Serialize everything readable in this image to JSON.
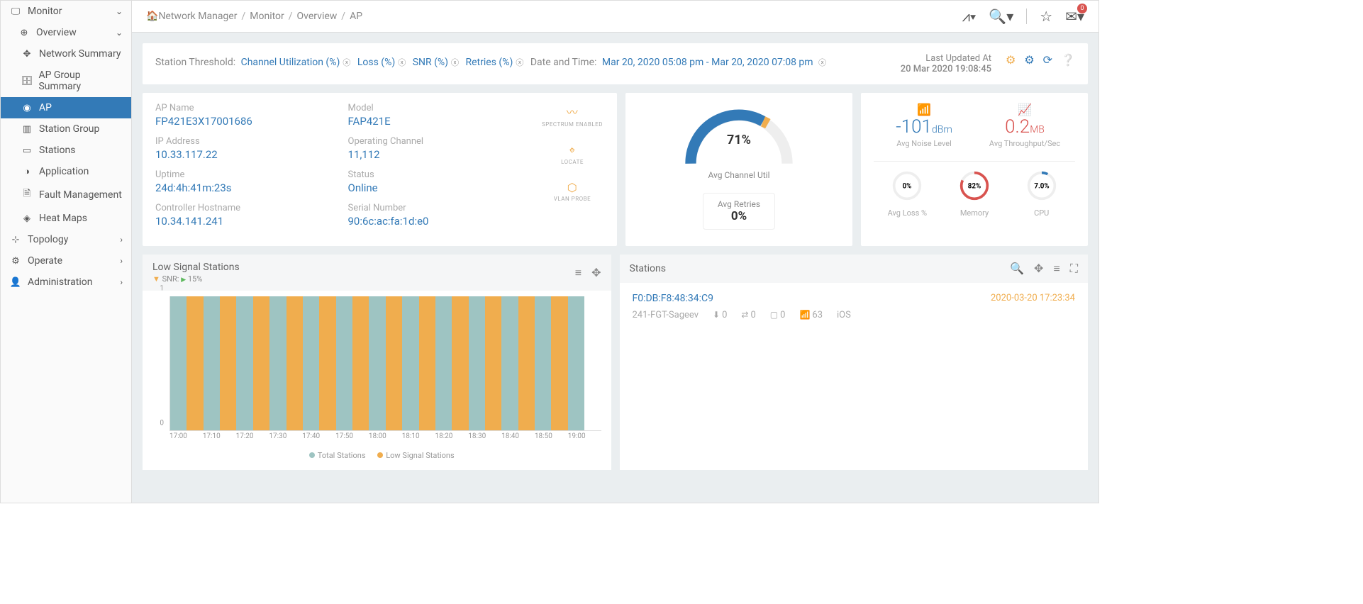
{
  "sidebar": {
    "items": [
      {
        "label": "Monitor",
        "icon": "🖵",
        "level": 1,
        "chev": "⌄"
      },
      {
        "label": "Overview",
        "icon": "⊕",
        "level": 2,
        "chev": "⌄"
      },
      {
        "label": "Network Summary",
        "icon": "✥",
        "level": 3
      },
      {
        "label": "AP Group Summary",
        "icon": "🗄",
        "level": 3
      },
      {
        "label": "AP",
        "icon": "◉",
        "level": 3,
        "active": true
      },
      {
        "label": "Station Group",
        "icon": "▥",
        "level": 3
      },
      {
        "label": "Stations",
        "icon": "▭",
        "level": 3
      },
      {
        "label": "Application",
        "icon": "◑",
        "level": 3
      },
      {
        "label": "Fault Management",
        "icon": "🗎",
        "level": 3
      },
      {
        "label": "Heat Maps",
        "icon": "◈",
        "level": 3
      },
      {
        "label": "Topology",
        "icon": "⊹",
        "level": 1,
        "chev": "›"
      },
      {
        "label": "Operate",
        "icon": "⚙",
        "level": 1,
        "chev": "›"
      },
      {
        "label": "Administration",
        "icon": "👤",
        "level": 1,
        "chev": "›"
      }
    ]
  },
  "breadcrumb": [
    "Network Manager",
    "Monitor",
    "Overview",
    "AP"
  ],
  "topbar": {
    "mail_count": "0"
  },
  "threshold": {
    "label": "Station Threshold:",
    "chips": [
      "Channel Utilization (%)",
      "Loss (%)",
      "SNR (%)",
      "Retries (%)"
    ],
    "datetime_label": "Date and Time:",
    "datetime_value": "Mar 20, 2020 05:08 pm - Mar 20, 2020 07:08 pm",
    "updated_label": "Last Updated At",
    "updated_value": "20 Mar 2020 19:08:45"
  },
  "ap": {
    "ap_name_label": "AP Name",
    "ap_name": "FP421E3X17001686",
    "ip_label": "IP Address",
    "ip": "10.33.117.22",
    "uptime_label": "Uptime",
    "uptime": "24d:4h:41m:23s",
    "ctrl_label": "Controller Hostname",
    "ctrl": "10.34.141.241",
    "model_label": "Model",
    "model": "FAP421E",
    "chan_label": "Operating Channel",
    "chan": "11,112",
    "status_label": "Status",
    "status": "Online",
    "serial_label": "Serial Number",
    "serial": "90:6c:ac:fa:1d:e0",
    "features": [
      {
        "icon": "〰",
        "label": "SPECTRUM ENABLED"
      },
      {
        "icon": "⌖",
        "label": "LOCATE"
      },
      {
        "icon": "⬡",
        "label": "VLAN PROBE"
      }
    ]
  },
  "gauge": {
    "value": "71%",
    "label": "Avg Channel Util",
    "retries_label": "Avg Retries",
    "retries_value": "0%"
  },
  "metrics": {
    "noise_value": "-101",
    "noise_unit": "dBm",
    "noise_label": "Avg Noise Level",
    "throughput_value": "0.2",
    "throughput_unit": "MB",
    "throughput_label": "Avg Throughput/Sec",
    "loss_value": "0%",
    "loss_label": "Avg Loss %",
    "mem_value": "82%",
    "mem_label": "Memory",
    "cpu_value": "7.0%",
    "cpu_label": "CPU"
  },
  "low_signal": {
    "title": "Low Signal Stations",
    "sub_label": "SNR:",
    "sub_value": "15%",
    "legend_total": "Total Stations",
    "legend_low": "Low Signal Stations"
  },
  "chart_data": {
    "type": "bar",
    "categories": [
      "17:00",
      "17:10",
      "17:20",
      "17:30",
      "17:40",
      "17:50",
      "18:00",
      "18:10",
      "18:20",
      "18:30",
      "18:40",
      "18:50",
      "19:00"
    ],
    "series": [
      {
        "name": "Total Stations",
        "values": [
          1,
          1,
          1,
          1,
          1,
          1,
          1,
          1,
          1,
          1,
          1,
          1,
          1
        ]
      },
      {
        "name": "Low Signal Stations",
        "values": [
          1,
          1,
          1,
          1,
          1,
          1,
          1,
          1,
          1,
          1,
          1,
          1,
          0
        ]
      }
    ],
    "ylim": [
      0,
      1
    ],
    "y_ticks": [
      0,
      1
    ]
  },
  "stations": {
    "title": "Stations",
    "rows": [
      {
        "mac": "F0:DB:F8:48:34:C9",
        "host": "241-FGT-Sageev",
        "v1": "0",
        "v2": "0",
        "v3": "0",
        "rssi": "63",
        "os": "iOS",
        "ts": "2020-03-20 17:23:34"
      }
    ]
  }
}
